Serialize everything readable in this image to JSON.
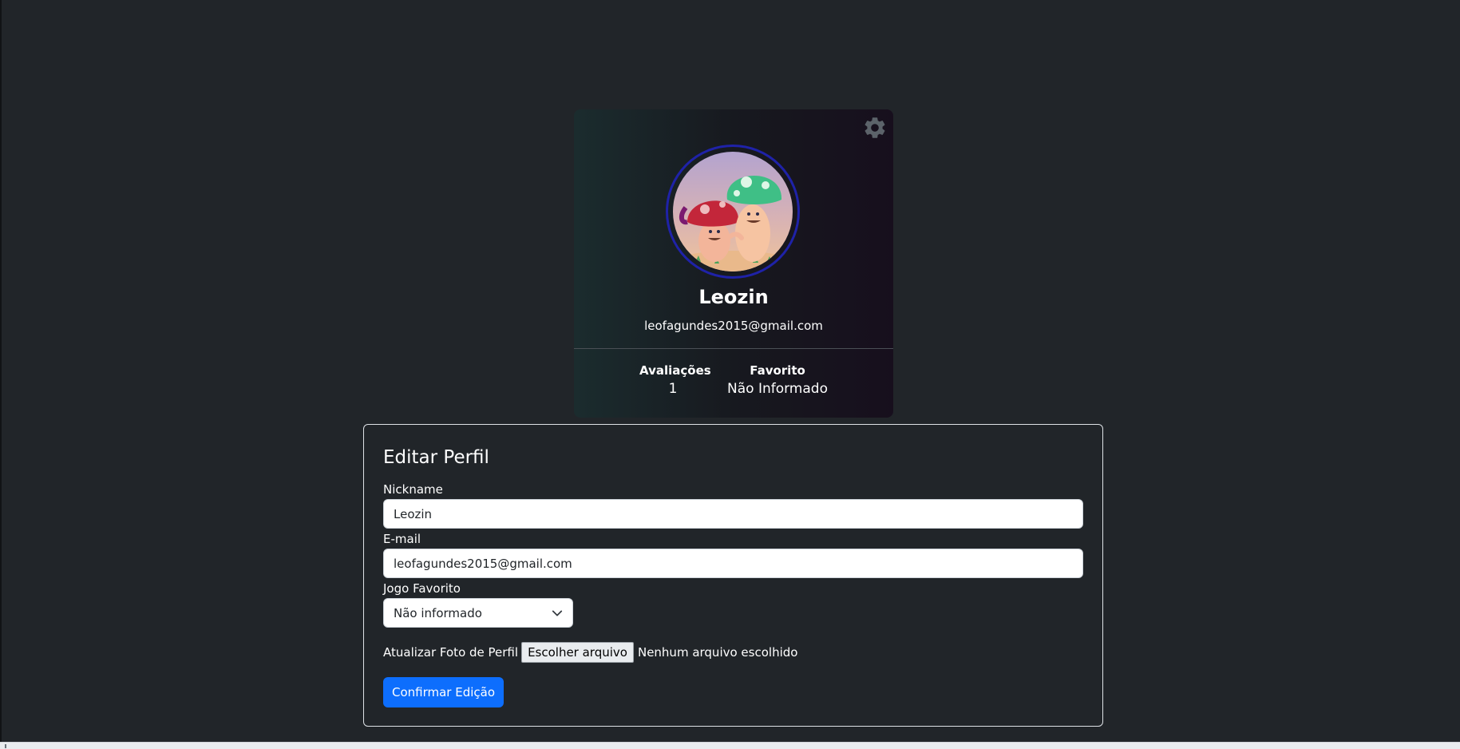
{
  "profile": {
    "name": "Leozin",
    "email": "leofagundes2015@gmail.com",
    "stats": {
      "reviews_label": "Avaliações",
      "reviews_value": "1",
      "favorite_label": "Favorito",
      "favorite_value": "Não Informado"
    },
    "settings_icon": "gear-icon",
    "avatar_icon": "mushroom-characters-avatar"
  },
  "edit_form": {
    "title": "Editar Perfil",
    "nickname_label": "Nickname",
    "nickname_value": "Leozin",
    "email_label": "E-mail",
    "email_value": "leofagundes2015@gmail.com",
    "favorite_game_label": "Jogo Favorito",
    "favorite_game_selected": "Não informado",
    "photo_label": "Atualizar Foto de Perfil",
    "file_button_label": "Escolher arquivo",
    "file_status": "Nenhum arquivo escolhido",
    "submit_label": "Confirmar Edição"
  },
  "colors": {
    "background": "#212529",
    "primary_button": "#0d6efd",
    "avatar_ring": "#1f22a8",
    "settings_icon": "#5c636a"
  }
}
